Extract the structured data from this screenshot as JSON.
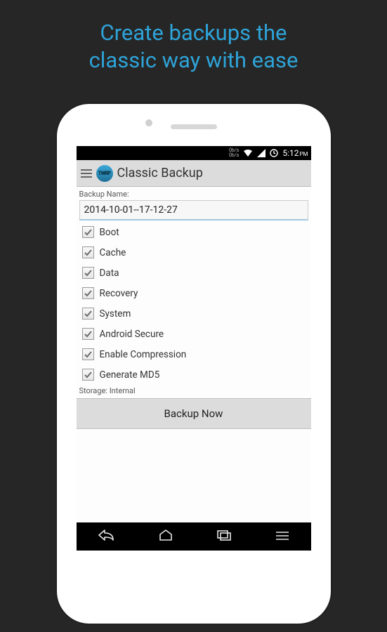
{
  "headline_line1": "Create backups the",
  "headline_line2": "classic way with ease",
  "statusbar": {
    "net_up": "0b/s",
    "net_down": "0b/s",
    "time": "5:12",
    "ampm": "PM"
  },
  "titlebar": {
    "app_badge": "TWRP",
    "title": "Classic Backup"
  },
  "backup_name_label": "Backup Name:",
  "backup_name_value": "2014-10-01--17-12-27",
  "partitions": [
    {
      "label": "Boot",
      "checked": true
    },
    {
      "label": "Cache",
      "checked": true
    },
    {
      "label": "Data",
      "checked": true
    },
    {
      "label": "Recovery",
      "checked": true
    },
    {
      "label": "System",
      "checked": true
    },
    {
      "label": "Android Secure",
      "checked": true
    },
    {
      "label": "Enable Compression",
      "checked": true
    },
    {
      "label": "Generate MD5",
      "checked": true
    }
  ],
  "storage_line": "Storage: Internal",
  "backup_button": "Backup Now"
}
